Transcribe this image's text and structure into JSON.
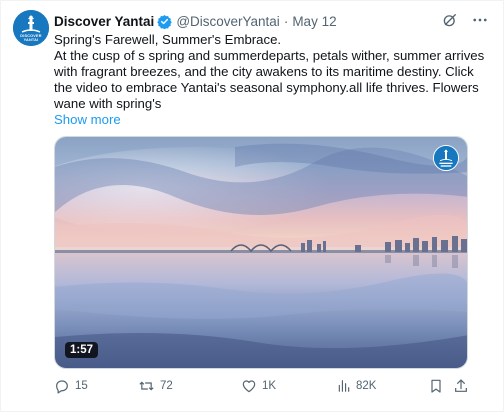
{
  "author": {
    "display_name": "Discover Yantai",
    "handle": "@DiscoverYantai",
    "separator": "·",
    "date": "May 12",
    "avatar_text": "DISCOVER YANTAI"
  },
  "tweet": {
    "title": "Spring's Farewell, Summer's Embrace.",
    "body": "At the cusp of s spring and summerdeparts, petals wither, summer arrives with fragrant breezes, and the city awakens to its maritime destiny. Click the video to embrace Yantai's seasonal symphony.all life thrives. Flowers wane with spring's",
    "show_more": "Show more"
  },
  "media": {
    "duration": "1:57"
  },
  "actions": {
    "replies": "15",
    "reposts": "72",
    "likes": "1K",
    "views": "82K"
  },
  "colors": {
    "accent": "#1d9bf0",
    "secondary_text": "#536471",
    "brand_blue": "#1777bf"
  },
  "icons": [
    "verified-badge-icon",
    "grok-icon",
    "more-icon",
    "reply-icon",
    "repost-icon",
    "like-icon",
    "views-icon",
    "bookmark-icon",
    "share-icon"
  ]
}
